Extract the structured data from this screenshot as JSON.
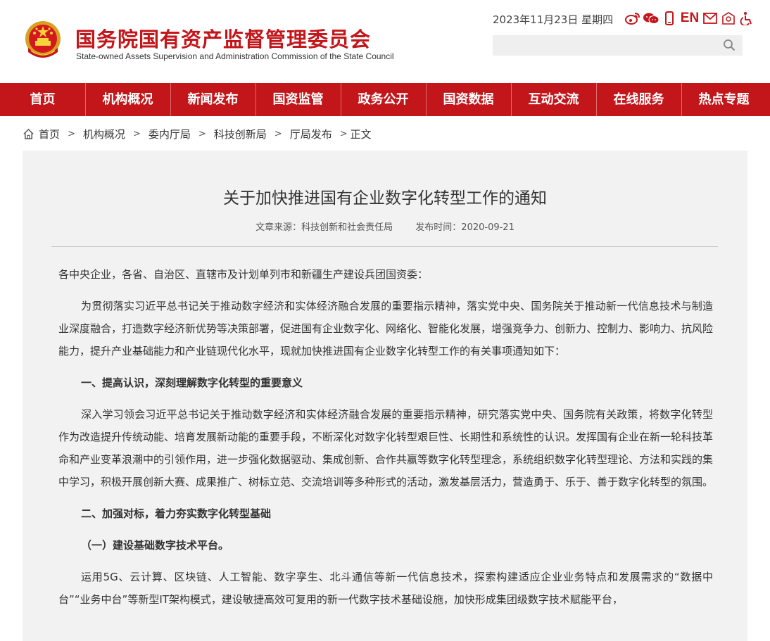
{
  "header": {
    "title": "国务院国有资产监督管理委员会",
    "subtitle": "State-owned Assets Supervision and Administration Commission of the State Council",
    "date": "2023年11月23日 星期四",
    "lang_label": "EN",
    "search_placeholder": "",
    "icons": [
      "weibo-icon",
      "wechat-icon",
      "mobile-icon",
      "mail-icon",
      "accessibility-mode-icon",
      "accessibility-icon"
    ]
  },
  "nav": {
    "items": [
      "首页",
      "机构概况",
      "新闻发布",
      "国资监管",
      "政务公开",
      "国资数据",
      "互动交流",
      "在线服务",
      "热点专题"
    ]
  },
  "breadcrumb": [
    "首页",
    "机构概况",
    "委内厅局",
    "科技创新局",
    "厅局发布",
    "正文"
  ],
  "article": {
    "title": "关于加快推进国有企业数字化转型工作的通知",
    "source": "文章来源：科技创新和社会责任局",
    "publish_time": "发布时间：2020-09-21",
    "salutation": "各中央企业，各省、自治区、直辖市及计划单列市和新疆生产建设兵团国资委：",
    "para1": "为贯彻落实习近平总书记关于推动数字经济和实体经济融合发展的重要指示精神，落实党中央、国务院关于推动新一代信息技术与制造业深度融合，打造数字经济新优势等决策部署，促进国有企业数字化、网络化、智能化发展，增强竞争力、创新力、控制力、影响力、抗风险能力，提升产业基础能力和产业链现代化水平，现就加快推进国有企业数字化转型工作的有关事项通知如下：",
    "heading1": "一、提高认识，深刻理解数字化转型的重要意义",
    "para2": "深入学习领会习近平总书记关于推动数字经济和实体经济融合发展的重要指示精神，研究落实党中央、国务院有关政策，将数字化转型作为改造提升传统动能、培育发展新动能的重要手段，不断深化对数字化转型艰巨性、长期性和系统性的认识。发挥国有企业在新一轮科技革命和产业变革浪潮中的引领作用，进一步强化数据驱动、集成创新、合作共赢等数字化转型理念，系统组织数字化转型理论、方法和实践的集中学习，积极开展创新大赛、成果推广、树标立范、交流培训等多种形式的活动，激发基层活力，营造勇于、乐于、善于数字化转型的氛围。",
    "heading2": "二、加强对标，着力夯实数字化转型基础",
    "subheading1": "（一）建设基础数字技术平台。",
    "para3": "运用5G、云计算、区块链、人工智能、数字孪生、北斗通信等新一代信息技术，探索构建适应企业业务特点和发展需求的“数据中台”“业务中台”等新型IT架构模式，建设敏捷高效可复用的新一代数字技术基础设施，加快形成集团级数字技术赋能平台，"
  },
  "colors": {
    "brand_red": "#c3161b",
    "article_bg": "#f2f2f2"
  }
}
